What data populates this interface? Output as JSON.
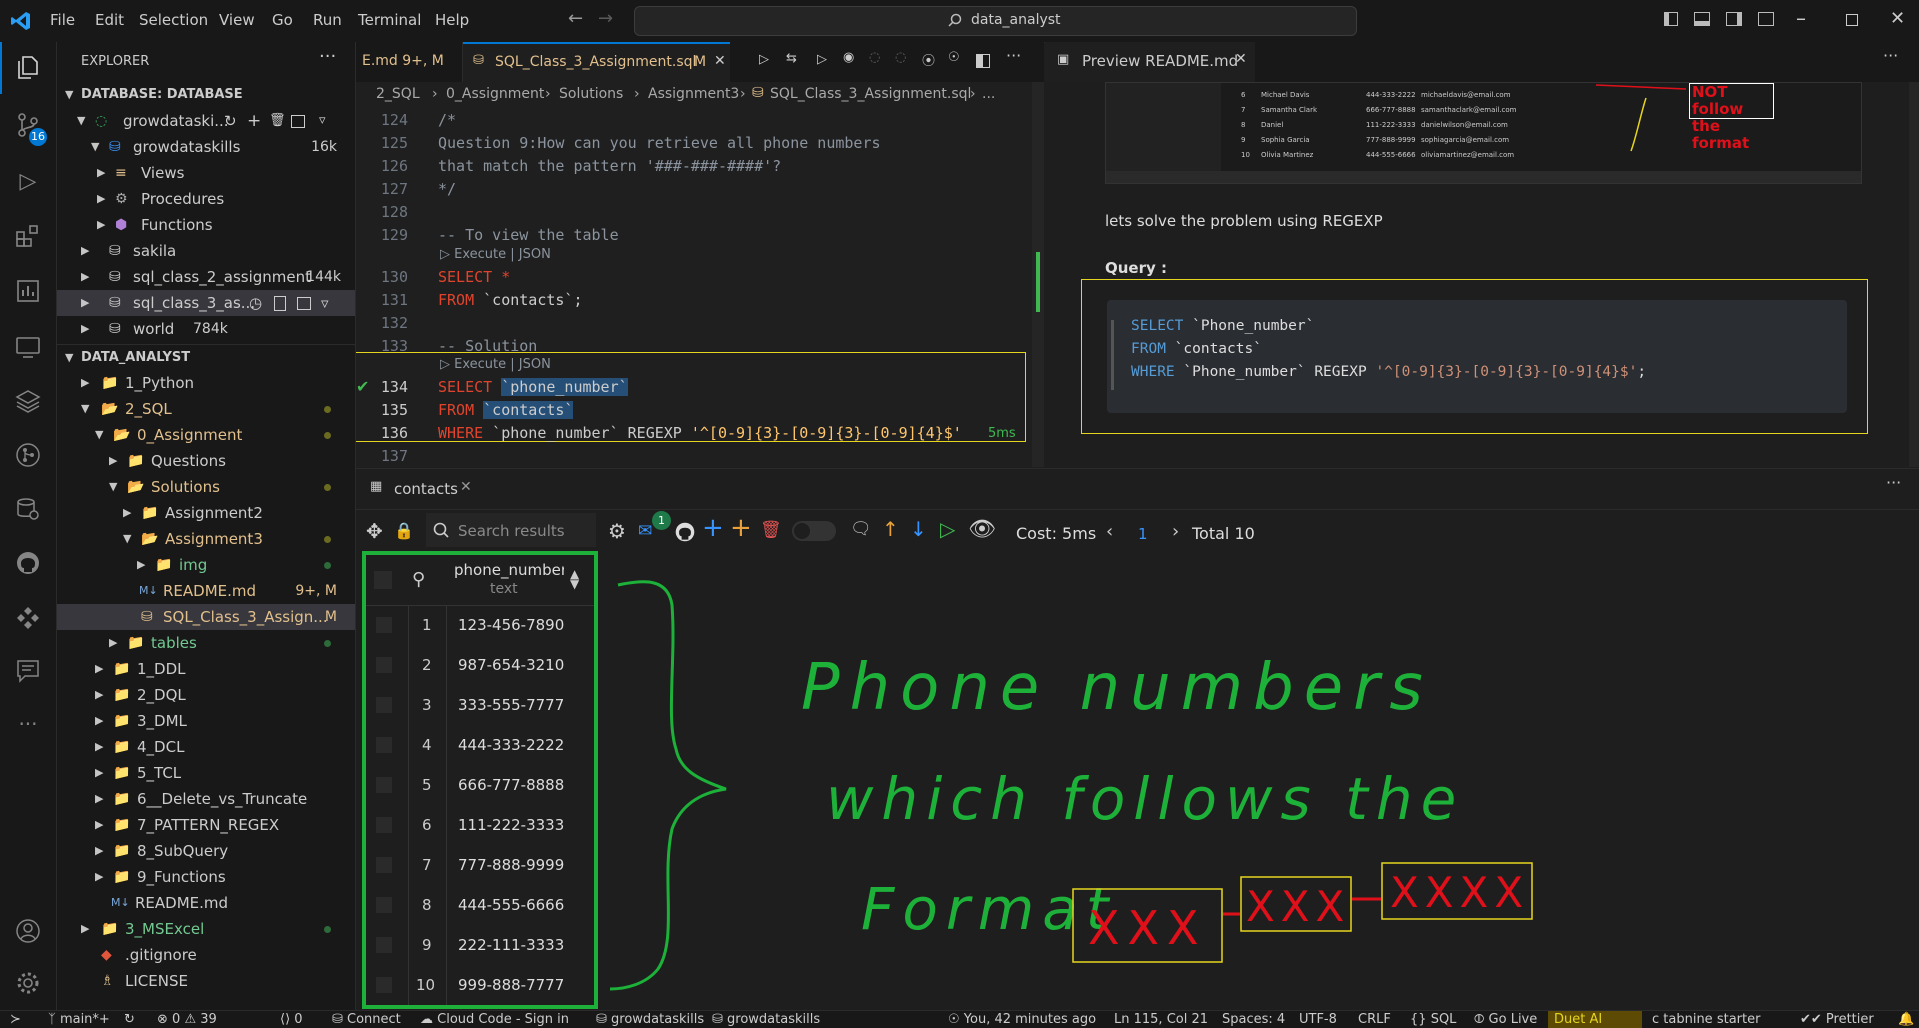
{
  "menu": [
    "File",
    "Edit",
    "Selection",
    "View",
    "Go",
    "Run",
    "Terminal",
    "Help"
  ],
  "search": {
    "text": "data_analyst"
  },
  "activity": {
    "scm_badge": "16"
  },
  "sidebar": {
    "title": "EXPLORER",
    "db_section": "DATABASE: DATABASE",
    "db_rows": [
      {
        "label": "growdataski...",
        "badge": ""
      },
      {
        "label": "growdataskills",
        "badge": "16k"
      },
      {
        "label": "Views",
        "badge": ""
      },
      {
        "label": "Procedures",
        "badge": ""
      },
      {
        "label": "Functions",
        "badge": ""
      },
      {
        "label": "sakila",
        "badge": ""
      },
      {
        "label": "sql_class_2_assignment",
        "badge": "144k"
      },
      {
        "label": "sql_class_3_as...",
        "badge": ""
      },
      {
        "label": "world",
        "badge": "784k"
      }
    ],
    "files_section": "DATA_ANALYST",
    "file_rows": [
      {
        "label": "1_Python",
        "badge": ""
      },
      {
        "label": "2_SQL",
        "badge": ""
      },
      {
        "label": "0_Assignment",
        "badge": ""
      },
      {
        "label": "Questions",
        "badge": ""
      },
      {
        "label": "Solutions",
        "badge": ""
      },
      {
        "label": "Assignment2",
        "badge": ""
      },
      {
        "label": "Assignment3",
        "badge": ""
      },
      {
        "label": "img",
        "badge": ""
      },
      {
        "label": "README.md",
        "badge": "9+, M"
      },
      {
        "label": "SQL_Class_3_Assign...",
        "badge": "M"
      },
      {
        "label": "tables",
        "badge": ""
      },
      {
        "label": "1_DDL",
        "badge": ""
      },
      {
        "label": "2_DQL",
        "badge": ""
      },
      {
        "label": "3_DML",
        "badge": ""
      },
      {
        "label": "4_DCL",
        "badge": ""
      },
      {
        "label": "5_TCL",
        "badge": ""
      },
      {
        "label": "6__Delete_vs_Truncate",
        "badge": ""
      },
      {
        "label": "7_PATTERN_REGEX",
        "badge": ""
      },
      {
        "label": "8_SubQuery",
        "badge": ""
      },
      {
        "label": "9_Functions",
        "badge": ""
      },
      {
        "label": "README.md",
        "badge": ""
      },
      {
        "label": "3_MSExcel",
        "badge": ""
      },
      {
        "label": ".gitignore",
        "badge": ""
      },
      {
        "label": "LICENSE",
        "badge": ""
      }
    ]
  },
  "tabs": {
    "tab1_label": "E.md 9+, M",
    "tab2_label": "SQL_Class_3_Assignment.sql",
    "tab2_badge": "M",
    "preview_label": "Preview README.md"
  },
  "breadcrumb": [
    "2_SQL",
    "0_Assignment",
    "Solutions",
    "Assignment3",
    "SQL_Class_3_Assignment.sql",
    "..."
  ],
  "editor": {
    "lines": [
      {
        "n": "124",
        "text": "/*"
      },
      {
        "n": "125",
        "text": "Question 9:How can you retrieve all phone numbers"
      },
      {
        "n": "126",
        "text": "that match the pattern '###-###-####'?"
      },
      {
        "n": "127",
        "text": "*/"
      },
      {
        "n": "128",
        "text": ""
      },
      {
        "n": "129",
        "text": "-- To view the table"
      },
      {
        "n": "130",
        "text": "SELECT *"
      },
      {
        "n": "131",
        "text": "FROM `contacts`;"
      },
      {
        "n": "132",
        "text": ""
      },
      {
        "n": "133",
        "text": "-- Solution"
      },
      {
        "n": "134",
        "text": "SELECT `phone_number`"
      },
      {
        "n": "135",
        "text": "FROM `contacts`"
      },
      {
        "n": "136",
        "text": "WHERE `phone_number` REGEXP '^[0-9]{3}-[0-9]{3}-[0-9]{4}$'"
      },
      {
        "n": "137",
        "text": ""
      }
    ],
    "codelens": "Execute | JSON",
    "exec_time": "5ms"
  },
  "preview": {
    "embedded_rows": [
      {
        "n": "6",
        "name": "Michael Davis",
        "phone": "444-333-2222",
        "email": "michaeldavis@email.com"
      },
      {
        "n": "7",
        "name": "Samantha Clark",
        "phone": "666-777-8888",
        "email": "samanthaclark@email.com"
      },
      {
        "n": "8",
        "name": "Daniel",
        "phone": "111-222-3333",
        "email": "danielwilson@email.com"
      },
      {
        "n": "9",
        "name": "Sophia Garcia",
        "phone": "777-888-9999",
        "email": "sophiagarcia@email.com"
      },
      {
        "n": "10",
        "name": "Olivia Martinez",
        "phone": "444-555-6666",
        "email": "oliviamartinez@email.com"
      }
    ],
    "annotation": [
      "NOT follow",
      "the format"
    ],
    "intro": "lets solve the problem using REGEXP",
    "heading": "Query :",
    "code": [
      "SELECT `Phone_number`",
      "FROM `contacts`",
      "WHERE `Phone_number` REGEXP '^[0-9]{3}-[0-9]{3}-[0-9]{4}$';"
    ]
  },
  "results": {
    "tab_label": "contacts",
    "search_placeholder": "Search results",
    "mail_badge": "1",
    "cost": "Cost: 5ms",
    "page": "1",
    "total": "Total 10",
    "column": "phone_number",
    "column_type": "text",
    "rows": [
      {
        "n": "1",
        "value": "123-456-7890"
      },
      {
        "n": "2",
        "value": "987-654-3210"
      },
      {
        "n": "3",
        "value": "333-555-7777"
      },
      {
        "n": "4",
        "value": "444-333-2222"
      },
      {
        "n": "5",
        "value": "666-777-8888"
      },
      {
        "n": "6",
        "value": "111-222-3333"
      },
      {
        "n": "7",
        "value": "777-888-9999"
      },
      {
        "n": "8",
        "value": "444-555-6666"
      },
      {
        "n": "9",
        "value": "222-111-3333"
      },
      {
        "n": "10",
        "value": "999-888-7777"
      }
    ]
  },
  "handwriting": {
    "line1": "Phone numbers",
    "line2": "which follows the",
    "line3": "Format",
    "box1": "XXX",
    "box2": "XXX",
    "box3": "XXXX"
  },
  "status": {
    "branch": "main*+",
    "errors": "0",
    "warnings": "39",
    "ports": "0",
    "connect": "Connect",
    "cloud": "Cloud Code - Sign in",
    "db1": "growdataskills",
    "db2": "growdataskills",
    "blame": "You, 42 minutes ago",
    "position": "Ln 115, Col 21",
    "spaces": "Spaces: 4",
    "encoding": "UTF-8",
    "eol": "CRLF",
    "language": "SQL",
    "golive": "Go Live",
    "duet": "Duet AI",
    "tabnine": "tabnine starter",
    "prettier": "Prettier"
  },
  "colors": {
    "accent_blue": "#0078d4",
    "modified_yellow": "#e2c08d",
    "folder_yellow": "#dcb67a",
    "hand_green": "#1db13a",
    "hand_red": "#e0101a",
    "highlight_yellow": "#e6d51e"
  }
}
